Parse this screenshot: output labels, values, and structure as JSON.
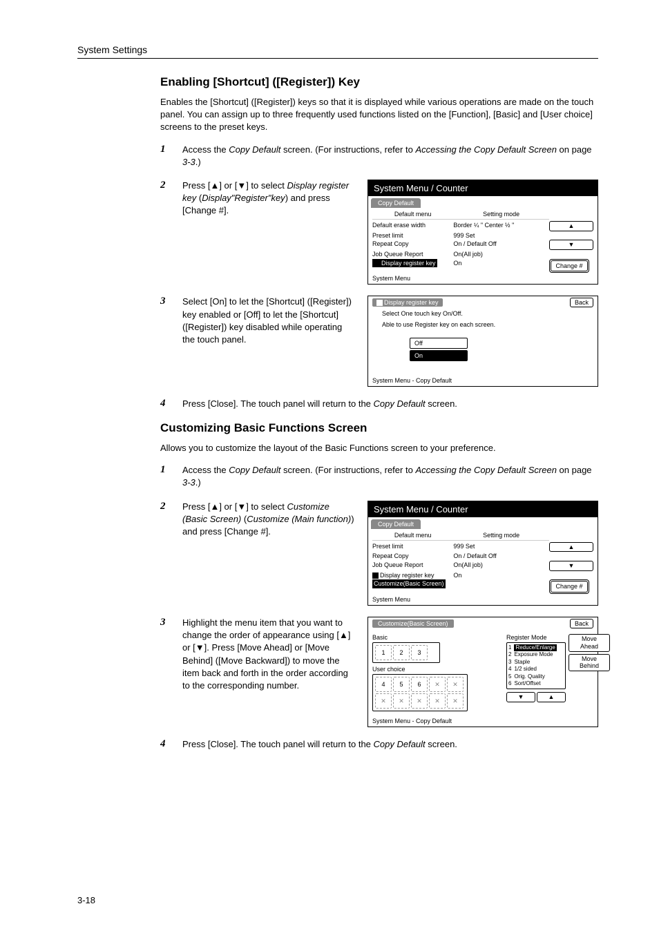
{
  "header": {
    "chapter": "System Settings"
  },
  "footer": {
    "page": "3-18"
  },
  "sections": [
    {
      "title": "Enabling [Shortcut] ([Register]) Key",
      "intro": "Enables the [Shortcut] ([Register]) keys so that it is displayed while various operations are made on the touch panel. You can assign up to three frequently used functions listed on the [Function], [Basic] and [User choice] screens to the preset keys.",
      "steps": [
        {
          "num": "1"
        },
        {
          "num": "2"
        },
        {
          "num": "3",
          "text": "Select [On] to let the [Shortcut] ([Register]) key enabled or [Off] to let the [Shortcut] ([Register]) key disabled while operating the touch panel."
        },
        {
          "num": "4"
        }
      ]
    },
    {
      "title": "Customizing Basic Functions Screen",
      "intro": "Allows you to customize the layout of the Basic Functions screen to your preference.",
      "steps": [
        {
          "num": "1"
        },
        {
          "num": "2"
        },
        {
          "num": "3",
          "text": "Highlight the menu item that you want to change the order of appearance using [▲] or [▼]. Press [Move Ahead] or [Move Behind] ([Move Backward]) to move the item back and forth in the order according to the corresponding number."
        },
        {
          "num": "4"
        }
      ]
    }
  ],
  "panel1": {
    "title": "System Menu / Counter",
    "tab": "Copy Default",
    "col_l": "Default menu",
    "col_r": "Setting mode",
    "rows": [
      {
        "l": "Default erase width",
        "r": "Border   ¼ \"   Center   ½ \""
      },
      {
        "l": "Preset limit",
        "r": "999 Set"
      },
      {
        "l": "Repeat Copy",
        "r": "On / Default Off"
      },
      {
        "l": "Job Queue Report",
        "r": "On(All job)"
      },
      {
        "l": "Display register key",
        "r": "On"
      }
    ],
    "change": "Change #",
    "footer": "System Menu"
  },
  "panel2": {
    "title": "Display register key",
    "back": "Back",
    "msg1": "Select One touch key On/Off.",
    "msg2": "Able to use Register key on each screen.",
    "off": "Off",
    "on": "On",
    "footer": "System Menu      -   Copy Default"
  },
  "panel3": {
    "title": "System Menu / Counter",
    "tab": "Copy Default",
    "col_l": "Default menu",
    "col_r": "Setting mode",
    "rows": [
      {
        "l": "Preset limit",
        "r": "999 Set"
      },
      {
        "l": "Repeat Copy",
        "r": "On / Default Off"
      },
      {
        "l": "Job Queue Report",
        "r": "On(All job)"
      },
      {
        "l": "Display register key",
        "r": "On"
      },
      {
        "l": "Customize(Basic Screen)",
        "r": ""
      }
    ],
    "change": "Change #",
    "footer": "System Menu"
  },
  "panel4": {
    "title": "Customize(Basic Screen)",
    "back": "Back",
    "basic": "Basic",
    "user": "User choice",
    "regmode": "Register Mode",
    "items": [
      "Reduce/Enlarge",
      "Exposure Mode",
      "Staple",
      "1/2 sided",
      "Orig. Quality",
      "Sort/Offset"
    ],
    "ahead": "Move Ahead",
    "behind": "Move Behind",
    "footer": "System Menu      -   Copy Default"
  }
}
